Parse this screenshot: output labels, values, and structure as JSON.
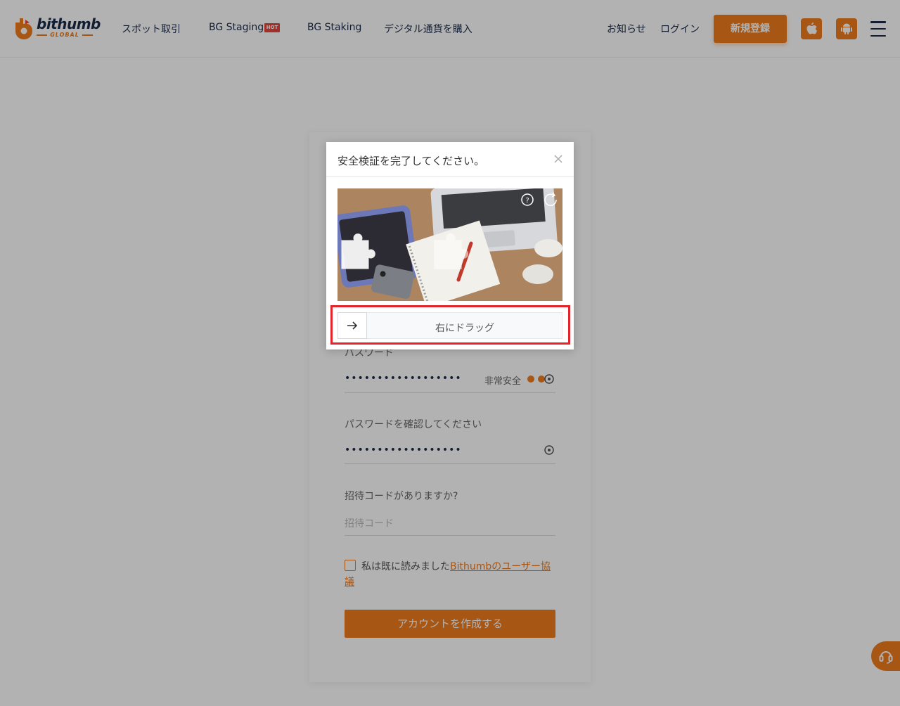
{
  "header": {
    "logo_word": "bithumb",
    "logo_sub": "GLOBAL",
    "nav": [
      {
        "label": "スポット取引"
      },
      {
        "label": "BG Staging"
      },
      {
        "label": "BG Staking"
      },
      {
        "label": "デジタル通貨を購入"
      }
    ],
    "hot_badge": "HOT",
    "notice_label": "お知らせ",
    "login_label": "ログイン",
    "signup_label": "新規登録"
  },
  "form": {
    "password_label": "パスワード",
    "password_value": "••••••••••••••••••",
    "strength_text": "非常安全",
    "confirm_label": "パスワードを確認してください",
    "confirm_value": "••••••••••••••••••",
    "invite_label": "招待コードがありますか?",
    "invite_placeholder": "招待コード",
    "agree_text": "私は既に読みました",
    "agree_link": "Bithumbのユーザー協議",
    "create_button": "アカウントを作成する"
  },
  "captcha": {
    "title": "安全検証を完了してください。",
    "drag_text": "右にドラッグ"
  },
  "colors": {
    "accent": "#ef7b1d",
    "navy": "#1d2b4a",
    "highlight": "#e3242b"
  },
  "icons": [
    "apple-icon",
    "android-icon",
    "menu-icon",
    "eye-icon",
    "close-icon",
    "arrow-right-icon",
    "headset-icon",
    "help-icon",
    "refresh-icon"
  ]
}
